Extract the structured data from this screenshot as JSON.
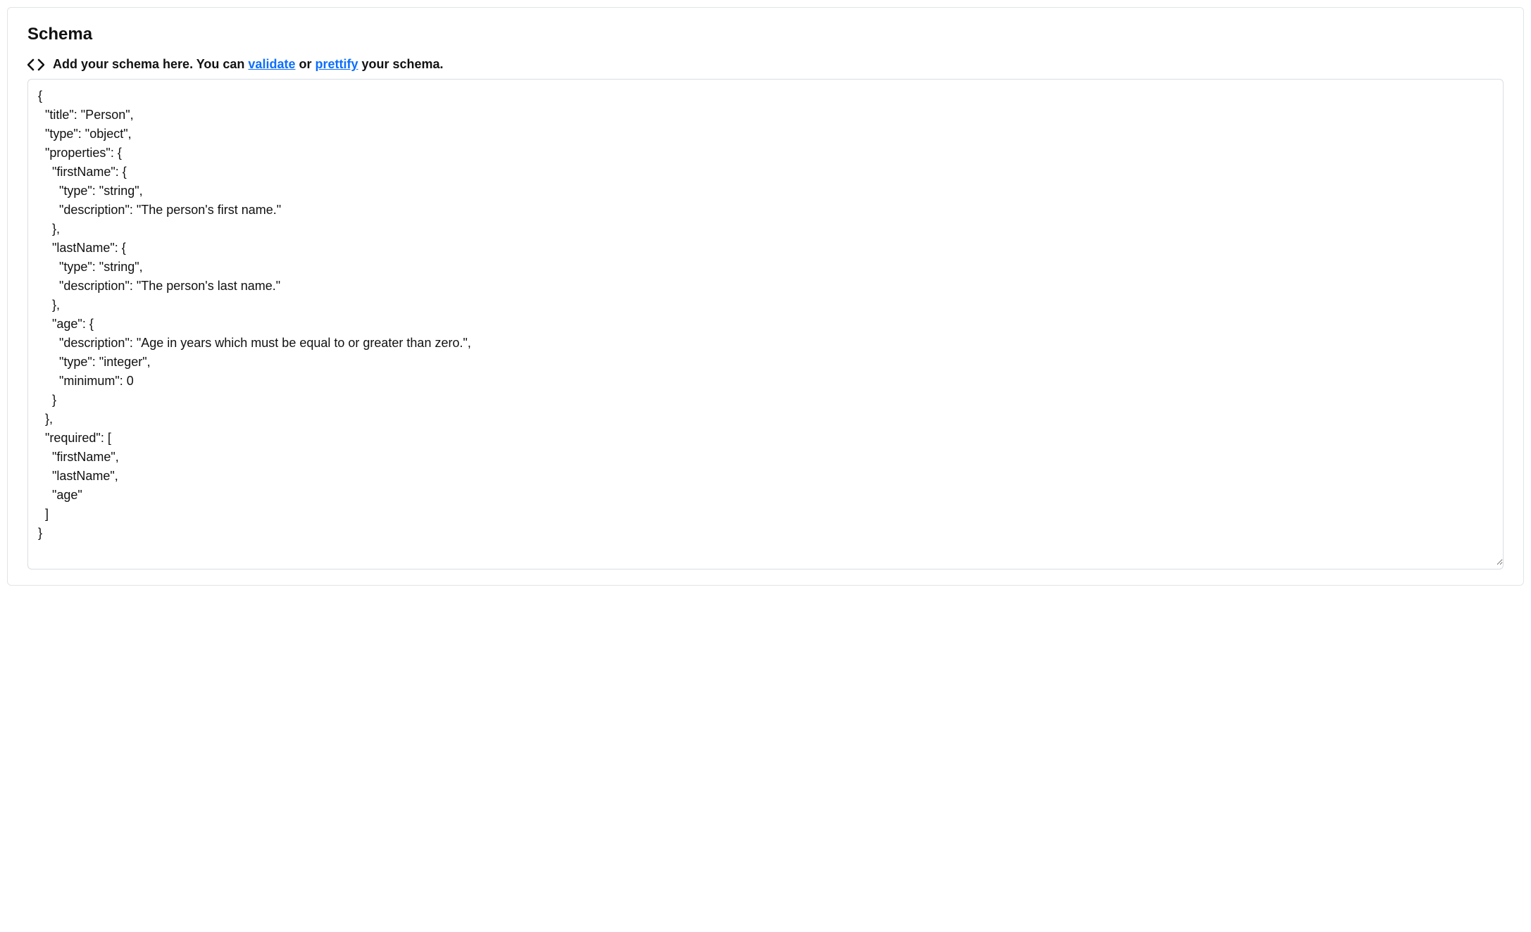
{
  "panel": {
    "title": "Schema",
    "helper_prefix": "Add your schema here. You can ",
    "validate_label": "validate",
    "middle_text": " or ",
    "prettify_label": "prettify",
    "helper_suffix": " your schema."
  },
  "editor": {
    "value": "{\n  \"title\": \"Person\",\n  \"type\": \"object\",\n  \"properties\": {\n    \"firstName\": {\n      \"type\": \"string\",\n      \"description\": \"The person's first name.\"\n    },\n    \"lastName\": {\n      \"type\": \"string\",\n      \"description\": \"The person's last name.\"\n    },\n    \"age\": {\n      \"description\": \"Age in years which must be equal to or greater than zero.\",\n      \"type\": \"integer\",\n      \"minimum\": 0\n    }\n  },\n  \"required\": [\n    \"firstName\",\n    \"lastName\",\n    \"age\"\n  ]\n}"
  }
}
